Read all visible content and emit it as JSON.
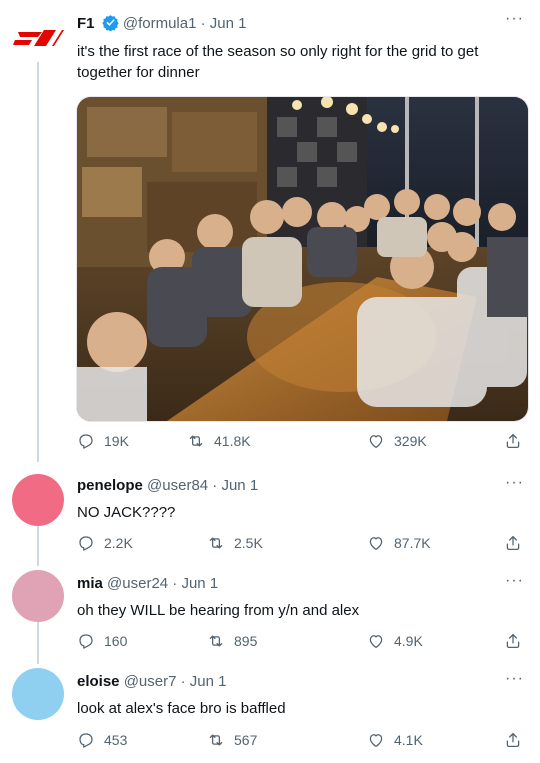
{
  "main_tweet": {
    "name": "F1",
    "handle": "@formula1",
    "date": "Jun 1",
    "text": "it's the first race of the season so only right for the grid to get together for dinner",
    "replies": "19K",
    "retweets": "41.8K",
    "likes": "329K",
    "logo_text": "F1",
    "photo_description_icon": "group-dinner-photo"
  },
  "replies": [
    {
      "name": "penelope",
      "handle": "@user84",
      "date": "Jun 1",
      "text": "NO JACK????",
      "replies": "2.2K",
      "retweets": "2.5K",
      "likes": "87.7K",
      "avatar_color": "#f26b85"
    },
    {
      "name": "mia",
      "handle": "@user24",
      "date": "Jun 1",
      "text": "oh they WILL be hearing from y/n and alex",
      "replies": "160",
      "retweets": "895",
      "likes": "4.9K",
      "avatar_color": "#e0a3b5"
    },
    {
      "name": "eloise",
      "handle": "@user7",
      "date": "Jun 1",
      "text": "look at alex's face bro is baffled",
      "replies": "453",
      "retweets": "567",
      "likes": "4.1K",
      "avatar_color": "#8fd0f0"
    }
  ],
  "colors": {
    "brand_red": "#e10600",
    "verified_blue": "#1d9bf0",
    "muted": "#536471",
    "thread_line": "#cfd9de"
  }
}
